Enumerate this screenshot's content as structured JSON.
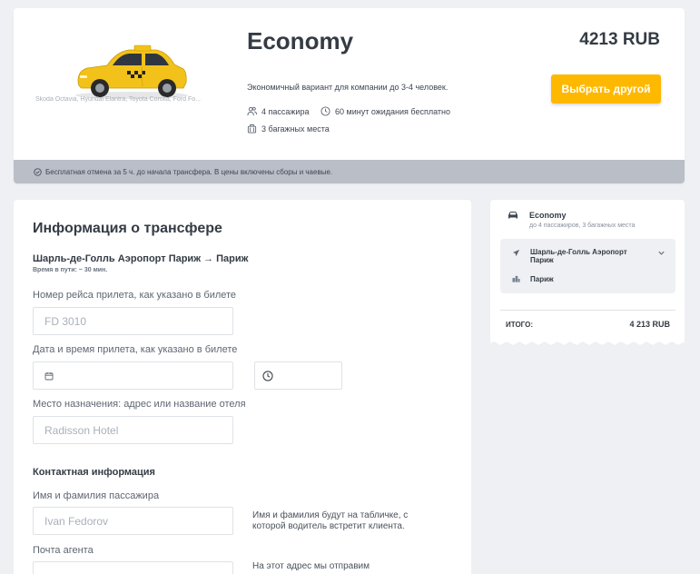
{
  "vehicle": {
    "class_name": "Economy",
    "models": "Skoda Octavia, Hyundai Elantra, Toyota Corolla, Ford Fo...",
    "description": "Экономичный вариант для компании до 3-4 человек.",
    "passengers": "4 пассажира",
    "waiting": "60 минут ожидания бесплатно",
    "luggage": "3 багажных места",
    "price": "4213 RUB",
    "change_button": "Выбрать другой",
    "notice": "Бесплатная отмена за 5 ч. до начала трансфера. В цены включены сборы и чаевые."
  },
  "form": {
    "title": "Информация о трансфере",
    "route": "Шарль-де-Голль Аэропорт Париж → Париж",
    "travel_time": "Время в пути: ~ 30 мин.",
    "flight_label": "Номер рейса прилета, как указано в билете",
    "flight_placeholder": "FD 3010",
    "datetime_label": "Дата и время прилета, как указано в билете",
    "destination_label": "Место назначения: адрес или название отеля",
    "destination_placeholder": "Radisson Hotel",
    "contact_title": "Контактная информация",
    "name_label": "Имя и фамилия пассажира",
    "name_placeholder": "Ivan Fedorov",
    "name_hint": "Имя и фамилия будут на табличке, с которой водитель встретит клиента.",
    "email_label": "Почта агента",
    "email_hint": "На этот адрес мы отправим"
  },
  "summary": {
    "class_name": "Economy",
    "capacity": "до 4 пассажиров, 3 багажных места",
    "from": "Шарль-де-Голль Аэропорт Париж",
    "to": "Париж",
    "total_label": "ИТОГО:",
    "total_value": "4 213 RUB"
  },
  "colors": {
    "accent": "#ffb800",
    "notice_bg": "#b9bec7",
    "page_bg": "#eef0f3",
    "taxi_yellow": "#f2c21a"
  }
}
